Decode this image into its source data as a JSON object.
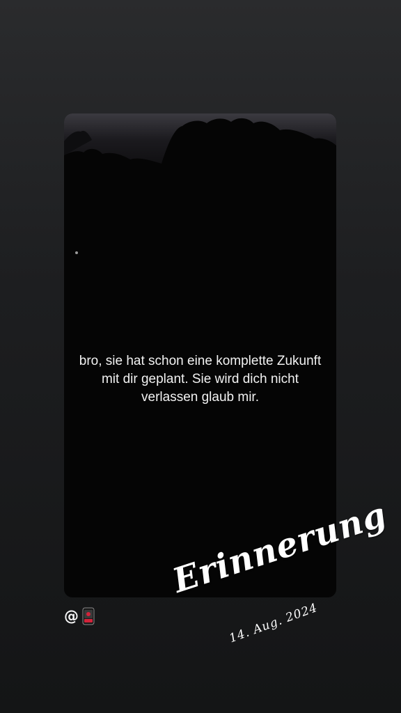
{
  "story": {
    "caption": "bro, sie hat schon eine komplette Zukunft mit dir geplant. Sie wird dich nicht verlassen glaub mir.",
    "mention": {
      "prefix": "@",
      "sticker_icon": "red-phone-icon"
    },
    "memory_sticker": {
      "title": "Erinnerung",
      "date": "14. Aug. 2024"
    }
  },
  "colors": {
    "background_top": "#2a2b2d",
    "background_bottom": "#141516",
    "card": "#050505",
    "text": "#f2f2f2",
    "phone_accent": "#d4233a"
  }
}
